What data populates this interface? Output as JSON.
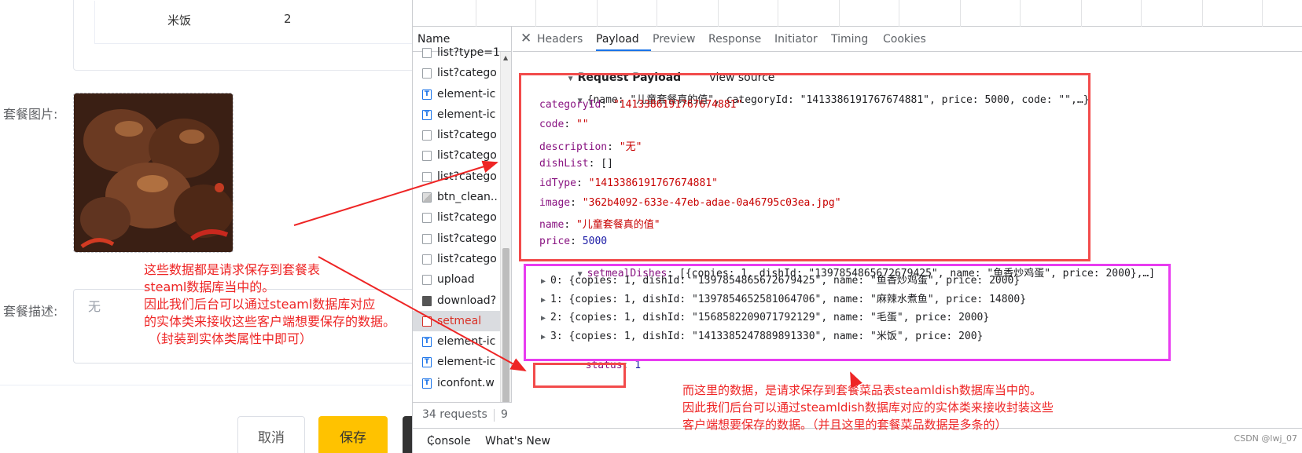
{
  "form": {
    "dish_row": {
      "name": "米饭",
      "copies": "2"
    },
    "image_label": "套餐图片:",
    "desc_label": "套餐描述:",
    "desc_value": "无",
    "cancel_label": "取消",
    "save_label": "保存",
    "save_color": "#ffc200"
  },
  "devtools": {
    "names_header": "Name",
    "network_items": [
      {
        "label": "list?type=1",
        "icon": "doc-icon"
      },
      {
        "label": "list?catego",
        "icon": "doc-icon"
      },
      {
        "label": "element-ic",
        "icon": "font-icon"
      },
      {
        "label": "element-ic",
        "icon": "font-icon"
      },
      {
        "label": "list?catego",
        "icon": "doc-icon"
      },
      {
        "label": "list?catego",
        "icon": "doc-icon"
      },
      {
        "label": "list?catego",
        "icon": "doc-icon"
      },
      {
        "label": "btn_clean..",
        "icon": "image-icon"
      },
      {
        "label": "list?catego",
        "icon": "doc-icon"
      },
      {
        "label": "list?catego",
        "icon": "doc-icon"
      },
      {
        "label": "list?catego",
        "icon": "doc-icon"
      },
      {
        "label": "upload",
        "icon": "doc-icon"
      },
      {
        "label": "download?",
        "icon": "download-icon"
      },
      {
        "label": "setmeal",
        "icon": "doc-icon",
        "selected": true
      },
      {
        "label": "element-ic",
        "icon": "font-icon"
      },
      {
        "label": "element-ic",
        "icon": "font-icon"
      },
      {
        "label": "iconfont.w",
        "icon": "font-icon"
      }
    ],
    "tabs": [
      "Headers",
      "Payload",
      "Preview",
      "Response",
      "Initiator",
      "Timing",
      "Cookies"
    ],
    "active_tab": "Payload",
    "requests_count": "34 requests",
    "status_trailing": "9",
    "drawer_tabs": [
      "Console",
      "What's New"
    ],
    "payload": {
      "section_title": "Request Payload",
      "view_source": "view source",
      "summary": "{name: \"儿童套餐真的值\", categoryId: \"1413386191767674881\", price: 5000, code: \"\",…}",
      "fields": [
        {
          "key": "categoryId",
          "value": "\"1413386191767674881\"",
          "type": "str"
        },
        {
          "key": "code",
          "value": "\"\"",
          "type": "str"
        },
        {
          "key": "description",
          "value": "\"无\"",
          "type": "str"
        },
        {
          "key": "dishList",
          "value": "[]",
          "type": "plain"
        },
        {
          "key": "idType",
          "value": "\"1413386191767674881\"",
          "type": "str"
        },
        {
          "key": "image",
          "value": "\"362b4092-633e-47eb-adae-0a46795c03ea.jpg\"",
          "type": "str"
        },
        {
          "key": "name",
          "value": "\"儿童套餐真的值\"",
          "type": "str"
        },
        {
          "key": "price",
          "value": "5000",
          "type": "num"
        }
      ],
      "setmeal_key": "setmealDishes",
      "setmeal_summary": "[{copies: 1, dishId: \"1397854865672679425\", name: \"鱼香炒鸡蛋\", price: 2000},…]",
      "setmeal_items": [
        "0: {copies: 1, dishId: \"1397854865672679425\", name: \"鱼香炒鸡蛋\", price: 2000}",
        "1: {copies: 1, dishId: \"1397854652581064706\", name: \"麻辣水煮鱼\", price: 14800}",
        "2: {copies: 1, dishId: \"1568582209071792129\", name: \"毛蛋\", price: 2000}",
        "3: {copies: 1, dishId: \"1413385247889891330\", name: \"米饭\", price: 200}"
      ],
      "status_key": "status",
      "status_value": "1"
    }
  },
  "annotations": {
    "note1_lines": [
      "这些数据都是请求保存到套餐表",
      "steaml数据库当中的。",
      "因此我们后台可以通过steaml数据库对应",
      "的实体类来接收这些客户端想要保存的数据。",
      "（封装到实体类属性中即可）"
    ],
    "note2_lines": [
      "而这里的数据，是请求保存到套餐菜品表steamldish数据库当中的。",
      "因此我们后台可以通过steamldish数据库对应的实体类来接收封装这些",
      "客户端想要保存的数据。（并且这里的套餐菜品数据是多条的）"
    ],
    "red_color": "#f24b4b",
    "magenta_color": "#e83cf0"
  },
  "watermark": "CSDN @lwj_07"
}
